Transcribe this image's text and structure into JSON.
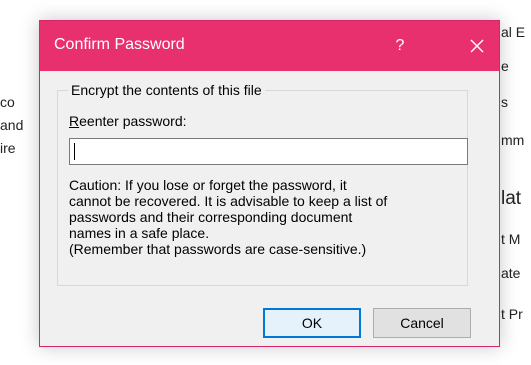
{
  "background": {
    "left_fragments": [
      "co",
      "and",
      "ire"
    ],
    "right_fragments": [
      "al E",
      "e",
      "s",
      "mm",
      "lat",
      "t M",
      "ate",
      "t Pr"
    ]
  },
  "dialog": {
    "title": "Confirm Password",
    "help_label": "?",
    "group_label": "Encrypt the contents of this file",
    "field_label_first_letter": "R",
    "field_label_rest": "eenter password:",
    "password_value": "",
    "caution_lines": [
      "Caution: If you lose or forget the password, it",
      "cannot be recovered. It is advisable to keep a list of",
      "passwords and their corresponding document",
      "names in a safe place.",
      "(Remember that passwords are case-sensitive.)"
    ],
    "ok_label": "OK",
    "cancel_label": "Cancel"
  },
  "colors": {
    "titlebar": "#e8306f",
    "dialog_bg": "#f0f0f0",
    "focus": "#0078d7"
  }
}
